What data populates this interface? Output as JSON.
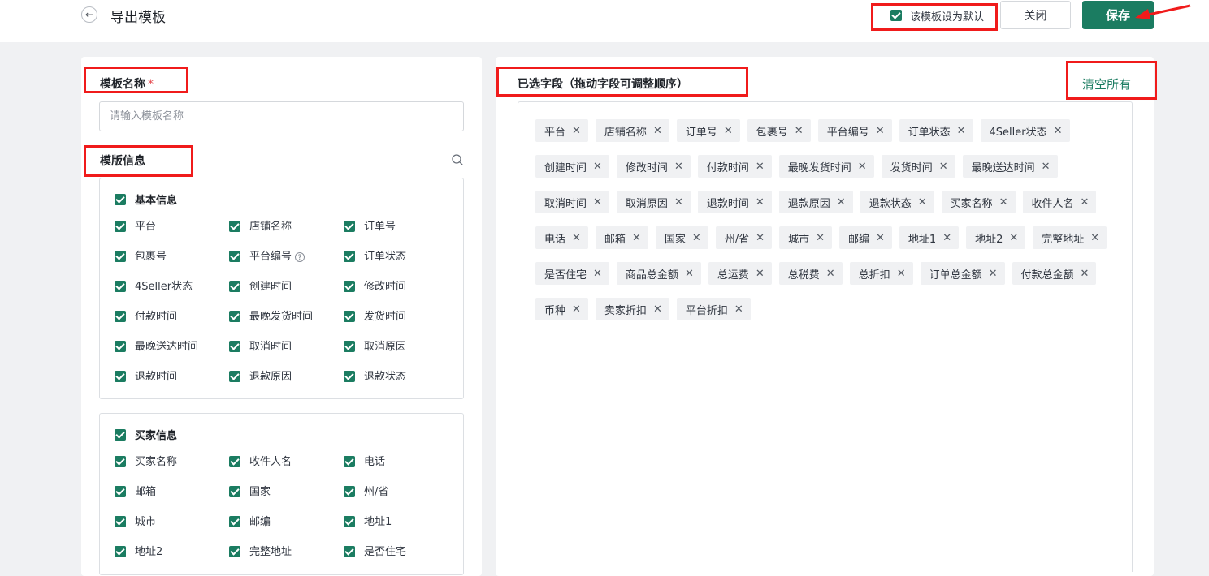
{
  "header": {
    "back_icon": "arrow-left-icon",
    "title": "导出模板",
    "default_label": "该模板设为默认",
    "default_checked": true,
    "close_label": "关闭",
    "save_label": "保存",
    "accent_color": "#1b7c61",
    "annotation_color": "#f01b1b"
  },
  "left": {
    "name_label": "模板名称",
    "required_mark": "*",
    "name_input": {
      "value": "",
      "placeholder": "请输入模板名称"
    },
    "info_label": "模版信息",
    "search_icon": "search-icon",
    "groups": [
      {
        "title": "基本信息",
        "checked": true,
        "items": [
          {
            "label": "平台",
            "checked": true
          },
          {
            "label": "店铺名称",
            "checked": true
          },
          {
            "label": "订单号",
            "checked": true
          },
          {
            "label": "包裹号",
            "checked": true
          },
          {
            "label": "平台编号",
            "checked": true,
            "help": "?"
          },
          {
            "label": "订单状态",
            "checked": true
          },
          {
            "label": "4Seller状态",
            "checked": true
          },
          {
            "label": "创建时间",
            "checked": true
          },
          {
            "label": "修改时间",
            "checked": true
          },
          {
            "label": "付款时间",
            "checked": true
          },
          {
            "label": "最晚发货时间",
            "checked": true
          },
          {
            "label": "发货时间",
            "checked": true
          },
          {
            "label": "最晚送达时间",
            "checked": true
          },
          {
            "label": "取消时间",
            "checked": true
          },
          {
            "label": "取消原因",
            "checked": true
          },
          {
            "label": "退款时间",
            "checked": true
          },
          {
            "label": "退款原因",
            "checked": true
          },
          {
            "label": "退款状态",
            "checked": true
          }
        ]
      },
      {
        "title": "买家信息",
        "checked": true,
        "items": [
          {
            "label": "买家名称",
            "checked": true
          },
          {
            "label": "收件人名",
            "checked": true
          },
          {
            "label": "电话",
            "checked": true
          },
          {
            "label": "邮箱",
            "checked": true
          },
          {
            "label": "国家",
            "checked": true
          },
          {
            "label": "州/省",
            "checked": true
          },
          {
            "label": "城市",
            "checked": true
          },
          {
            "label": "邮编",
            "checked": true
          },
          {
            "label": "地址1",
            "checked": true
          },
          {
            "label": "地址2",
            "checked": true
          },
          {
            "label": "完整地址",
            "checked": true
          },
          {
            "label": "是否住宅",
            "checked": true
          }
        ]
      }
    ]
  },
  "right": {
    "selected_label": "已选字段（拖动字段可调整顺序）",
    "clear_all_label": "清空所有",
    "remove_icon": "close-icon",
    "remove_glyph": "✕",
    "chips": [
      "平台",
      "店铺名称",
      "订单号",
      "包裹号",
      "平台编号",
      "订单状态",
      "4Seller状态",
      "创建时间",
      "修改时间",
      "付款时间",
      "最晚发货时间",
      "发货时间",
      "最晚送达时间",
      "取消时间",
      "取消原因",
      "退款时间",
      "退款原因",
      "退款状态",
      "买家名称",
      "收件人名",
      "电话",
      "邮箱",
      "国家",
      "州/省",
      "城市",
      "邮编",
      "地址1",
      "地址2",
      "完整地址",
      "是否住宅",
      "商品总金额",
      "总运费",
      "总税费",
      "总折扣",
      "订单总金额",
      "付款总金额",
      "币种",
      "卖家折扣",
      "平台折扣"
    ]
  }
}
